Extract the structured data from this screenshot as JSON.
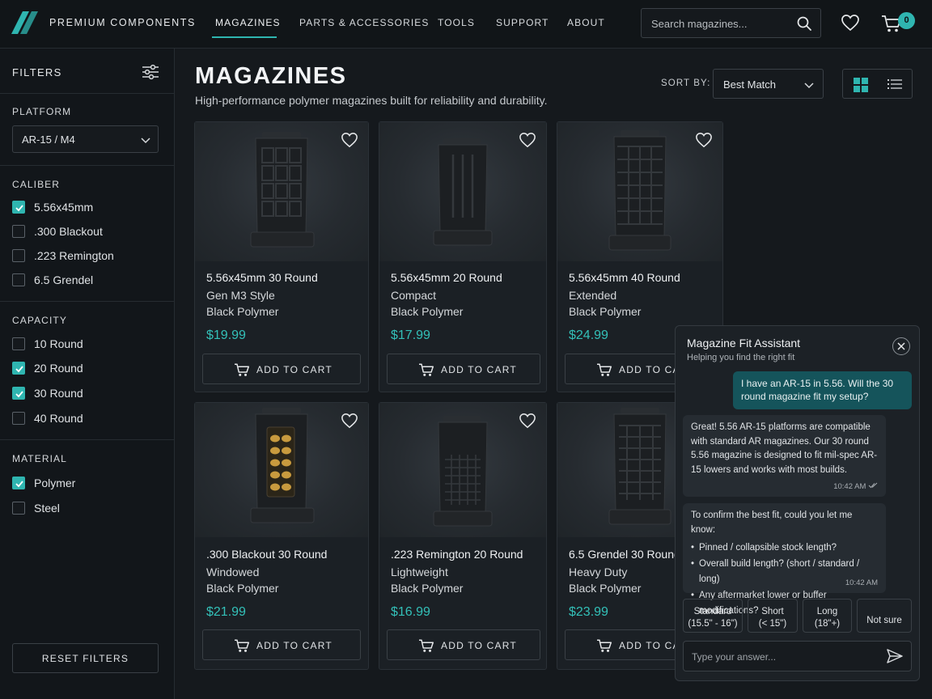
{
  "header": {
    "brand": "PREMIUM COMPONENTS",
    "nav": [
      "MAGAZINES",
      "PARTS & ACCESSORIES",
      "TOOLS",
      "SUPPORT",
      "ABOUT"
    ],
    "active_nav": "MAGAZINES",
    "search_placeholder": "Search magazines...",
    "cart_count": "0",
    "accent_color": "#2fb5b0"
  },
  "sidebar": {
    "title": "FILTERS",
    "platform": {
      "label": "PLATFORM",
      "selected": "AR-15 / M4"
    },
    "caliber": {
      "label": "CALIBER",
      "options": [
        {
          "label": "5.56x45mm",
          "checked": true
        },
        {
          "label": ".300 Blackout",
          "checked": false
        },
        {
          "label": ".223 Remington",
          "checked": false
        },
        {
          "label": "6.5 Grendel",
          "checked": false
        }
      ]
    },
    "capacity": {
      "label": "CAPACITY",
      "options": [
        {
          "label": "10 Round",
          "checked": false
        },
        {
          "label": "20 Round",
          "checked": true
        },
        {
          "label": "30 Round",
          "checked": true
        },
        {
          "label": "40 Round",
          "checked": false
        }
      ]
    },
    "material": {
      "label": "MATERIAL",
      "options": [
        {
          "label": "Polymer",
          "checked": true
        },
        {
          "label": "Steel",
          "checked": false
        }
      ]
    },
    "reset_label": "RESET FILTERS"
  },
  "main": {
    "title": "MAGAZINES",
    "subtitle": "High-performance polymer magazines built for reliability and durability.",
    "sort_label": "SORT BY:",
    "sort_value": "Best Match",
    "add_to_cart_label": "ADD TO CART",
    "products": [
      {
        "name": "5.56x45mm 30 Round",
        "variant": "Gen M3 Style",
        "material": "Black Polymer",
        "price": "$19.99"
      },
      {
        "name": "5.56x45mm 20 Round",
        "variant": "Compact",
        "material": "Black Polymer",
        "price": "$17.99"
      },
      {
        "name": "5.56x45mm 40 Round",
        "variant": "Extended",
        "material": "Black Polymer",
        "price": "$24.99"
      },
      {
        "name": ".300 Blackout 30 Round",
        "variant": "Windowed",
        "material": "Black Polymer",
        "price": "$21.99"
      },
      {
        "name": ".223 Remington 20 Round",
        "variant": "Lightweight",
        "material": "Black Polymer",
        "price": "$16.99"
      },
      {
        "name": "6.5 Grendel 30 Round",
        "variant": "Heavy Duty",
        "material": "Black Polymer",
        "price": "$23.99"
      }
    ]
  },
  "chat": {
    "title": "Magazine Fit Assistant",
    "subtitle": "Helping you find the right fit",
    "user_message": "I have an AR-15 in 5.56. Will the 30 round magazine fit my setup?",
    "bot_message_1": "Great! 5.56 AR-15 platforms are compatible with standard AR magazines. Our 30 round 5.56 magazine is designed to fit mil-spec AR-15 lowers and works with most builds.",
    "bot_time_1": "10:42 AM",
    "bot_message_2_intro": "To confirm the best fit, could you let me know:",
    "bot_message_2_items": [
      "Pinned / collapsible stock length?",
      "Overall build length? (short / standard / long)",
      "Any aftermarket lower or buffer modifications?"
    ],
    "bot_time_2": "10:42 AM",
    "quick_replies": [
      {
        "line1": "Standard",
        "line2": "(15.5\" - 16\")"
      },
      {
        "line1": "Short",
        "line2": "(< 15\")"
      },
      {
        "line1": "Long",
        "line2": "(18\"+)"
      },
      {
        "line1": "Not sure",
        "line2": ""
      }
    ],
    "input_placeholder": "Type your answer..."
  }
}
